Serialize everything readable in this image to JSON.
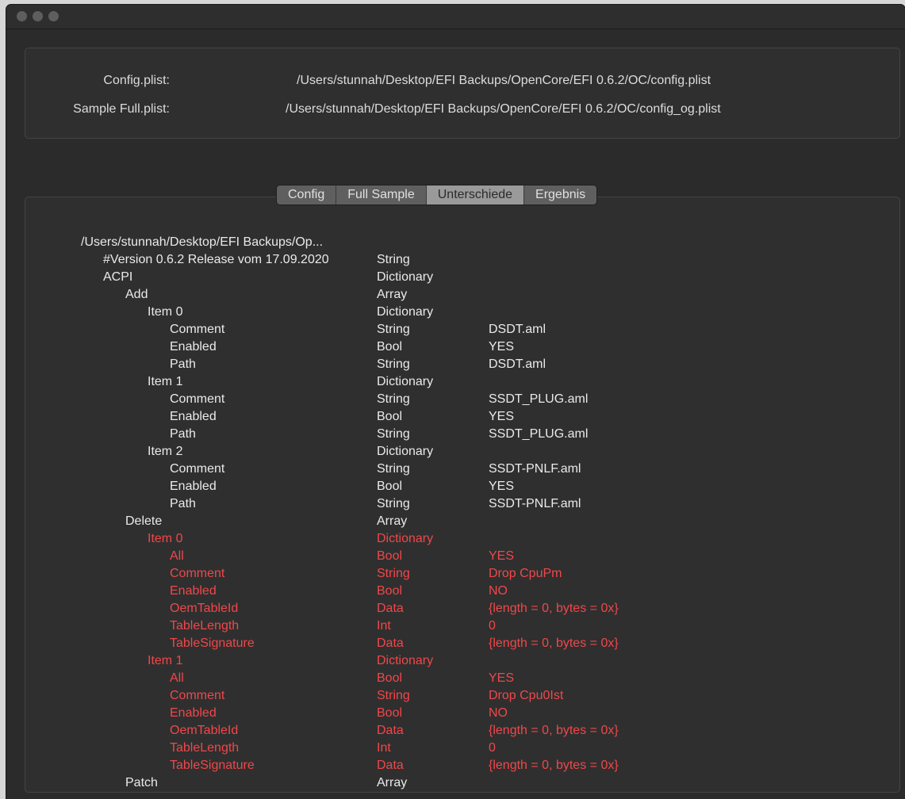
{
  "paths": {
    "config_label": "Config.plist:",
    "config_value": "/Users/stunnah/Desktop/EFI Backups/OpenCore/EFI 0.6.2/OC/config.plist",
    "sample_label": "Sample Full.plist:",
    "sample_value": "/Users/stunnah/Desktop/EFI Backups/OpenCore/EFI 0.6.2/OC/config_og.plist"
  },
  "tabs": [
    {
      "label": "Config"
    },
    {
      "label": "Full Sample"
    },
    {
      "label": "Unterschiede",
      "active": true
    },
    {
      "label": "Ergebnis"
    }
  ],
  "colors": {
    "diff": "#f0474a",
    "text": "#eaeaea",
    "background": "#2b2b2b"
  },
  "tree": [
    {
      "depth": 0,
      "key": "/Users/stunnah/Desktop/EFI Backups/Op...",
      "type": "",
      "value": ""
    },
    {
      "depth": 1,
      "key": "#Version 0.6.2 Release vom 17.09.2020",
      "type": "String",
      "value": ""
    },
    {
      "depth": 1,
      "key": "ACPI",
      "type": "Dictionary",
      "value": ""
    },
    {
      "depth": 2,
      "key": "Add",
      "type": "Array",
      "value": ""
    },
    {
      "depth": 3,
      "key": "Item 0",
      "type": "Dictionary",
      "value": ""
    },
    {
      "depth": 4,
      "key": "Comment",
      "type": "String",
      "value": "DSDT.aml"
    },
    {
      "depth": 4,
      "key": "Enabled",
      "type": "Bool",
      "value": "YES"
    },
    {
      "depth": 4,
      "key": "Path",
      "type": "String",
      "value": "DSDT.aml"
    },
    {
      "depth": 3,
      "key": "Item 1",
      "type": "Dictionary",
      "value": ""
    },
    {
      "depth": 4,
      "key": "Comment",
      "type": "String",
      "value": "SSDT_PLUG.aml"
    },
    {
      "depth": 4,
      "key": "Enabled",
      "type": "Bool",
      "value": "YES"
    },
    {
      "depth": 4,
      "key": "Path",
      "type": "String",
      "value": "SSDT_PLUG.aml"
    },
    {
      "depth": 3,
      "key": "Item 2",
      "type": "Dictionary",
      "value": ""
    },
    {
      "depth": 4,
      "key": "Comment",
      "type": "String",
      "value": "SSDT-PNLF.aml"
    },
    {
      "depth": 4,
      "key": "Enabled",
      "type": "Bool",
      "value": "YES"
    },
    {
      "depth": 4,
      "key": "Path",
      "type": "String",
      "value": "SSDT-PNLF.aml"
    },
    {
      "depth": 2,
      "key": "Delete",
      "type": "Array",
      "value": ""
    },
    {
      "depth": 3,
      "key": "Item 0",
      "type": "Dictionary",
      "value": "",
      "diff": true
    },
    {
      "depth": 4,
      "key": "All",
      "type": "Bool",
      "value": "YES",
      "diff": true
    },
    {
      "depth": 4,
      "key": "Comment",
      "type": "String",
      "value": "Drop CpuPm",
      "diff": true
    },
    {
      "depth": 4,
      "key": "Enabled",
      "type": "Bool",
      "value": "NO",
      "diff": true
    },
    {
      "depth": 4,
      "key": "OemTableId",
      "type": "Data",
      "value": "{length = 0, bytes = 0x}",
      "diff": true
    },
    {
      "depth": 4,
      "key": "TableLength",
      "type": "Int",
      "value": "0",
      "diff": true
    },
    {
      "depth": 4,
      "key": "TableSignature",
      "type": "Data",
      "value": "{length = 0, bytes = 0x}",
      "diff": true
    },
    {
      "depth": 3,
      "key": "Item 1",
      "type": "Dictionary",
      "value": "",
      "diff": true
    },
    {
      "depth": 4,
      "key": "All",
      "type": "Bool",
      "value": "YES",
      "diff": true
    },
    {
      "depth": 4,
      "key": "Comment",
      "type": "String",
      "value": "Drop Cpu0Ist",
      "diff": true
    },
    {
      "depth": 4,
      "key": "Enabled",
      "type": "Bool",
      "value": "NO",
      "diff": true
    },
    {
      "depth": 4,
      "key": "OemTableId",
      "type": "Data",
      "value": "{length = 0, bytes = 0x}",
      "diff": true
    },
    {
      "depth": 4,
      "key": "TableLength",
      "type": "Int",
      "value": "0",
      "diff": true
    },
    {
      "depth": 4,
      "key": "TableSignature",
      "type": "Data",
      "value": "{length = 0, bytes = 0x}",
      "diff": true
    },
    {
      "depth": 2,
      "key": "Patch",
      "type": "Array",
      "value": ""
    }
  ]
}
